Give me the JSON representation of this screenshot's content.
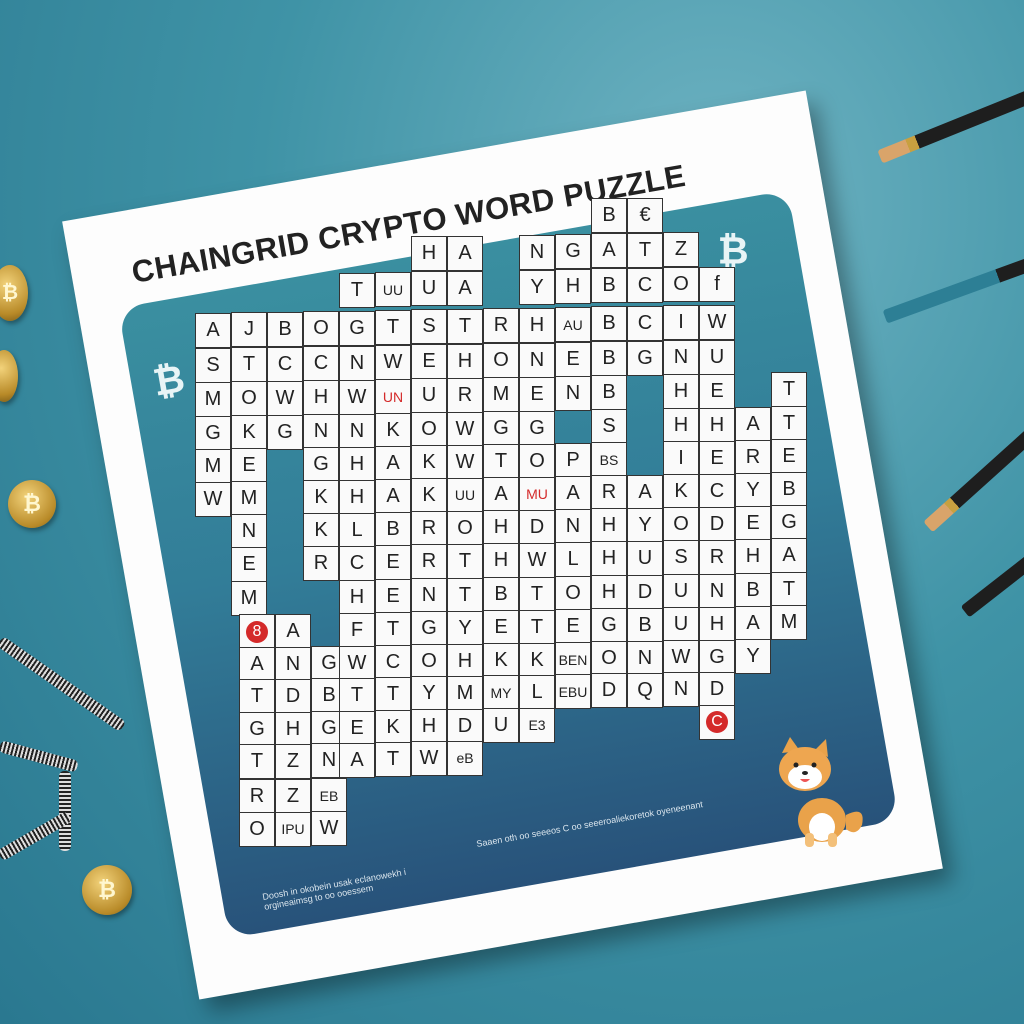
{
  "title": "CHAINGRID CRYPTO WORD PUZZLE",
  "bitcoin_symbol": "₿",
  "footer_left": [
    "Doosh in okobein usak eclanowekh i",
    "orgineaimsg to oo ooessem"
  ],
  "footer_right": "Saaen oth oo seeeos C oo seeeroaliekoretok oyeneenant",
  "colors": {
    "background": "#3f93a6",
    "panel_top": "#3a8fa0",
    "panel_bottom": "#28527a",
    "highlight": "#d42a2a"
  },
  "grid": {
    "rows": [
      [
        "",
        "",
        "",
        "",
        "",
        "",
        "",
        "",
        "",
        "",
        "",
        "B",
        "€",
        "",
        "",
        "",
        "",
        ""
      ],
      [
        "",
        "",
        "",
        "",
        "",
        "",
        "H",
        "A",
        "",
        "N",
        "G",
        "A",
        "T",
        "Z",
        "",
        "",
        "",
        ""
      ],
      [
        "",
        "",
        "",
        "",
        "T",
        "UU",
        "U",
        "A",
        "",
        "Y",
        "H",
        "B",
        "C",
        "O",
        "f",
        "",
        "",
        ""
      ],
      [
        "A",
        "J",
        "B",
        "O",
        "G",
        "T",
        "S",
        "T",
        "R",
        "H",
        "AU",
        "B",
        "C",
        "I",
        "W",
        "",
        "",
        ""
      ],
      [
        "S",
        "T",
        "C",
        "C",
        "N",
        "W",
        "E",
        "H",
        "O",
        "N",
        "E",
        "B",
        "G",
        "N",
        "U",
        "",
        "",
        ""
      ],
      [
        "M",
        "O",
        "W",
        "H",
        "W",
        "UN",
        "U",
        "R",
        "M",
        "E",
        "N",
        "B",
        "",
        "H",
        "E",
        "",
        "T",
        ""
      ],
      [
        "G",
        "K",
        "G",
        "N",
        "N",
        "K",
        "O",
        "W",
        "G",
        "G",
        "",
        "S",
        "",
        "H",
        "H",
        "A",
        "T",
        ""
      ],
      [
        "M",
        "E",
        "",
        "G",
        "H",
        "A",
        "K",
        "W",
        "T",
        "O",
        "P",
        "BS",
        "",
        "I",
        "E",
        "R",
        "E",
        ""
      ],
      [
        "W",
        "M",
        "",
        "K",
        "H",
        "A",
        "K",
        "UU",
        "A",
        "MU",
        "A",
        "R",
        "A",
        "K",
        "C",
        "Y",
        "B",
        ""
      ],
      [
        "",
        "N",
        "",
        "K",
        "L",
        "B",
        "R",
        "O",
        "H",
        "D",
        "N",
        "H",
        "Y",
        "O",
        "D",
        "E",
        "G",
        ""
      ],
      [
        "",
        "E",
        "",
        "R",
        "C",
        "E",
        "R",
        "T",
        "H",
        "W",
        "L",
        "H",
        "U",
        "S",
        "R",
        "H",
        "A",
        ""
      ],
      [
        "",
        "M",
        "",
        "",
        "H",
        "E",
        "N",
        "T",
        "B",
        "T",
        "O",
        "H",
        "D",
        "U",
        "N",
        "B",
        "T",
        ""
      ],
      [
        "",
        "8",
        "A",
        "",
        "F",
        "T",
        "G",
        "Y",
        "E",
        "T",
        "E",
        "G",
        "B",
        "U",
        "H",
        "A",
        "M",
        ""
      ],
      [
        "",
        "A",
        "N",
        "G",
        "W",
        "C",
        "O",
        "H",
        "K",
        "K",
        "BEN",
        "O",
        "N",
        "W",
        "G",
        "Y",
        "",
        ""
      ],
      [
        "",
        "T",
        "D",
        "B",
        "T",
        "T",
        "Y",
        "M",
        "MY",
        "L",
        "EBU",
        "D",
        "Q",
        "N",
        "D",
        "",
        "",
        ""
      ],
      [
        "",
        "G",
        "H",
        "G",
        "E",
        "K",
        "H",
        "D",
        "U",
        "E3",
        "",
        "",
        "",
        "",
        "C",
        "",
        "",
        ""
      ],
      [
        "",
        "T",
        "Z",
        "N",
        "A",
        "T",
        "W",
        "eB",
        "",
        "",
        "",
        "",
        "",
        "",
        "",
        "",
        "",
        ""
      ],
      [
        "",
        "R",
        "Z",
        "EB",
        "",
        "",
        "",
        "",
        "",
        "",
        "",
        "",
        "",
        "",
        "",
        "",
        "",
        ""
      ],
      [
        "",
        "O",
        "IPU",
        "W",
        "",
        "",
        "",
        "",
        "",
        "",
        "",
        "",
        "",
        "",
        "",
        "",
        "",
        ""
      ]
    ],
    "red_text_cells": [
      [
        5,
        5
      ],
      [
        8,
        9
      ]
    ],
    "red_badge_cells": [
      [
        12,
        1
      ],
      [
        15,
        14
      ]
    ]
  }
}
